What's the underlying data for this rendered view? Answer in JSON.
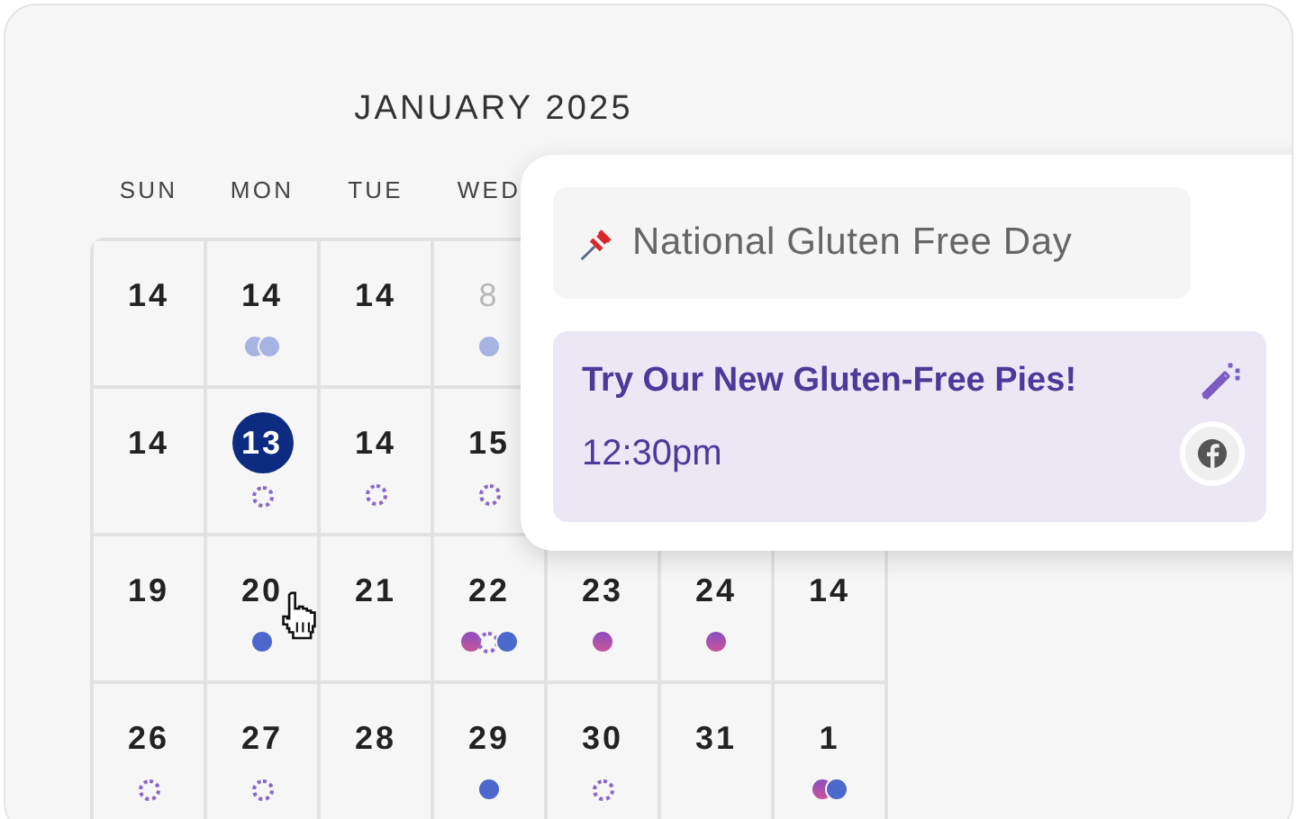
{
  "calendar": {
    "title": "JANUARY 2025",
    "weekdays": [
      "SUN",
      "MON",
      "TUE",
      "WED"
    ],
    "weeks": [
      {
        "days": [
          {
            "day": "14",
            "muted": false,
            "selected": false
          },
          {
            "day": "14",
            "muted": false,
            "selected": false,
            "dots": [
              {
                "kind": "solid",
                "color": "#a7b3e2"
              },
              {
                "kind": "solid",
                "color": "#a7b3e2"
              }
            ]
          },
          {
            "day": "14",
            "muted": false,
            "selected": false
          },
          {
            "day": "8",
            "muted": true,
            "selected": false,
            "dots": [
              {
                "kind": "solid",
                "color": "#a7b3e2"
              }
            ]
          }
        ]
      },
      {
        "days": [
          {
            "day": "14",
            "muted": false,
            "selected": false
          },
          {
            "day": "13",
            "muted": false,
            "selected": true,
            "dots": [
              {
                "kind": "ring"
              }
            ]
          },
          {
            "day": "14",
            "muted": false,
            "selected": false,
            "dots": [
              {
                "kind": "ring"
              }
            ]
          },
          {
            "day": "15",
            "muted": false,
            "selected": false,
            "dots": [
              {
                "kind": "ring"
              }
            ]
          }
        ]
      },
      {
        "days": [
          {
            "day": "19",
            "muted": false,
            "selected": false
          },
          {
            "day": "20",
            "muted": false,
            "selected": false,
            "dots": [
              {
                "kind": "solid",
                "color": "#4d68cc"
              }
            ]
          },
          {
            "day": "21",
            "muted": false,
            "selected": false
          },
          {
            "day": "22",
            "muted": false,
            "selected": false,
            "dots": [
              {
                "kind": "gradient"
              },
              {
                "kind": "ring"
              },
              {
                "kind": "solid",
                "color": "#4d68cc"
              }
            ]
          },
          {
            "day": "23",
            "muted": false,
            "selected": false,
            "dots": [
              {
                "kind": "gradient"
              }
            ]
          },
          {
            "day": "24",
            "muted": false,
            "selected": false,
            "dots": [
              {
                "kind": "gradient"
              }
            ]
          },
          {
            "day": "14",
            "muted": false,
            "selected": false
          }
        ]
      },
      {
        "days": [
          {
            "day": "26",
            "muted": false,
            "selected": false,
            "dots": [
              {
                "kind": "ring"
              }
            ]
          },
          {
            "day": "27",
            "muted": false,
            "selected": false,
            "dots": [
              {
                "kind": "ring"
              }
            ]
          },
          {
            "day": "28",
            "muted": false,
            "selected": false
          },
          {
            "day": "29",
            "muted": false,
            "selected": false,
            "dots": [
              {
                "kind": "solid",
                "color": "#4d68cc"
              }
            ]
          },
          {
            "day": "30",
            "muted": false,
            "selected": false,
            "dots": [
              {
                "kind": "ring"
              }
            ]
          },
          {
            "day": "31",
            "muted": false,
            "selected": false
          },
          {
            "day": "1",
            "muted": false,
            "selected": false,
            "dots": [
              {
                "kind": "gradient"
              },
              {
                "kind": "solid",
                "color": "#4d68cc"
              }
            ]
          }
        ]
      }
    ]
  },
  "popup": {
    "holiday": "National Gluten Free Day",
    "event": {
      "title": "Try Our New Gluten-Free Pies!",
      "time": "12:30pm"
    }
  }
}
